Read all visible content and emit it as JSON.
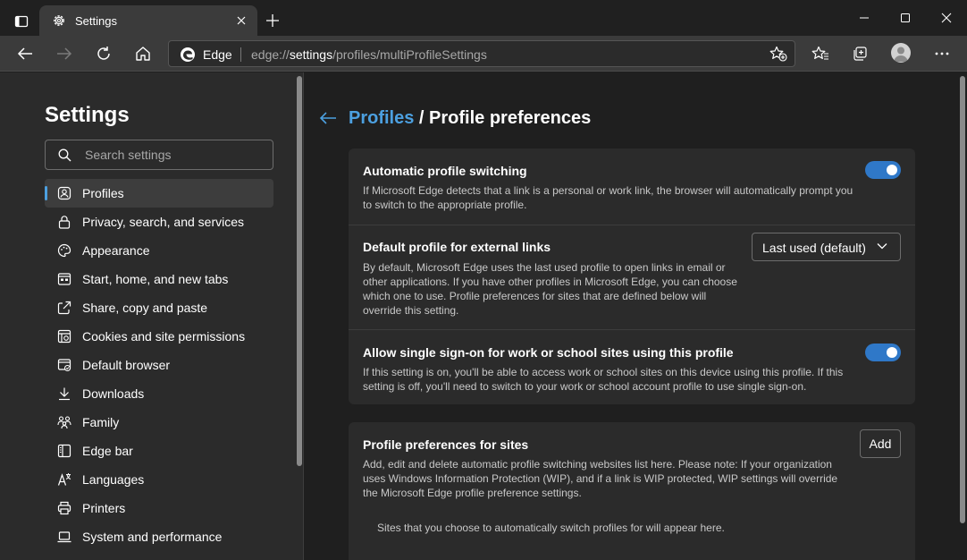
{
  "window": {
    "tab_title": "Settings"
  },
  "toolbar": {
    "address_label": "Edge",
    "url_prefix": "edge://",
    "url_highlight": "settings",
    "url_rest": "/profiles/multiProfileSettings"
  },
  "sidebar": {
    "title": "Settings",
    "search_placeholder": "Search settings",
    "items": [
      {
        "label": "Profiles",
        "icon": "profile-icon",
        "active": true
      },
      {
        "label": "Privacy, search, and services",
        "icon": "lock-icon"
      },
      {
        "label": "Appearance",
        "icon": "palette-icon"
      },
      {
        "label": "Start, home, and new tabs",
        "icon": "window-icon"
      },
      {
        "label": "Share, copy and paste",
        "icon": "share-icon"
      },
      {
        "label": "Cookies and site permissions",
        "icon": "cookie-icon"
      },
      {
        "label": "Default browser",
        "icon": "browser-icon"
      },
      {
        "label": "Downloads",
        "icon": "download-icon"
      },
      {
        "label": "Family",
        "icon": "family-icon"
      },
      {
        "label": "Edge bar",
        "icon": "sidebar-icon"
      },
      {
        "label": "Languages",
        "icon": "language-icon"
      },
      {
        "label": "Printers",
        "icon": "printer-icon"
      },
      {
        "label": "System and performance",
        "icon": "laptop-icon"
      }
    ]
  },
  "main": {
    "breadcrumb_parent": "Profiles",
    "breadcrumb_separator": "/",
    "breadcrumb_current": "Profile preferences",
    "auto_switch": {
      "title": "Automatic profile switching",
      "description": "If Microsoft Edge detects that a link is a personal or work link, the browser will automatically prompt you to switch to the appropriate profile.",
      "enabled": true
    },
    "default_profile": {
      "title": "Default profile for external links",
      "description": "By default, Microsoft Edge uses the last used profile to open links in email or other applications. If you have other profiles in Microsoft Edge, you can choose which one to use. Profile preferences for sites that are defined below will override this setting.",
      "selected": "Last used (default)"
    },
    "sso": {
      "title": "Allow single sign-on for work or school sites using this profile",
      "description": "If this setting is on, you'll be able to access work or school sites on this device using this profile. If this setting is off, you'll need to switch to your work or school account profile to use single sign-on.",
      "enabled": true
    },
    "site_prefs": {
      "title": "Profile preferences for sites",
      "description": "Add, edit and delete automatic profile switching websites list here. Please note: If your organization uses Windows Information Protection (WIP), and if a link is WIP protected, WIP settings will override the Microsoft Edge profile preference settings.",
      "add_label": "Add",
      "empty_message": "Sites that you choose to automatically switch profiles for will appear here."
    }
  },
  "colors": {
    "accent": "#4ca0e0",
    "toggle_on": "#2f78c8",
    "panel": "#2b2b2b",
    "background": "#1f1f1f"
  }
}
